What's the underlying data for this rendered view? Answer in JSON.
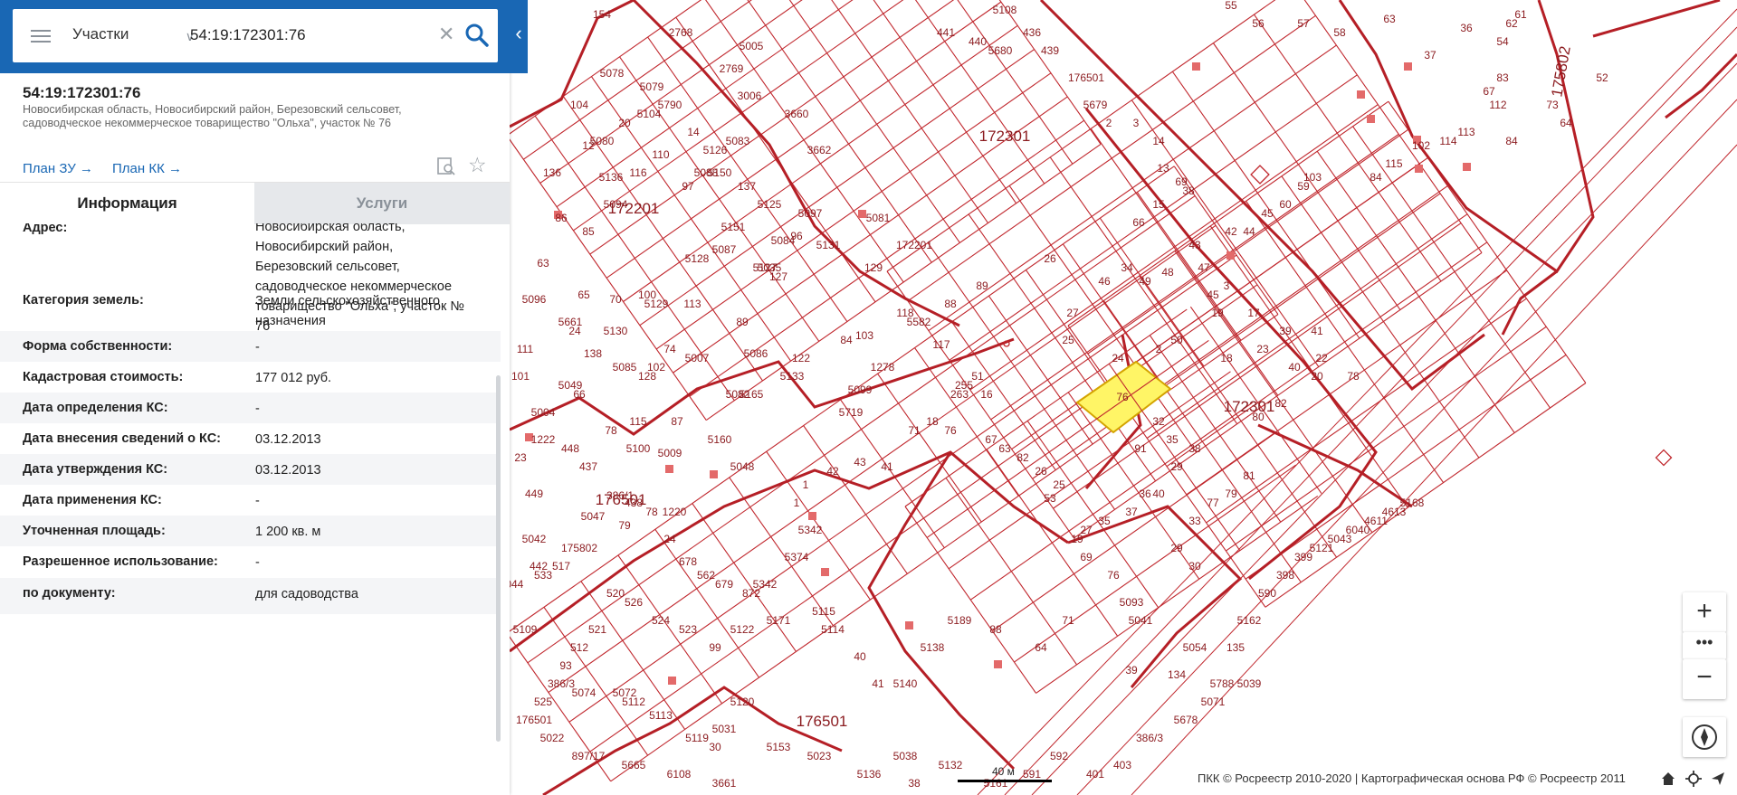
{
  "search": {
    "layer": "Участки",
    "query": "54:19:172301:76"
  },
  "object": {
    "number": "54:19:172301:76",
    "address_lines": [
      "Новосибирская область, Новосибирский район, Березовский сельсовет,",
      "садоводческое некоммерческое товарищество \"Ольха\", участок № 76"
    ],
    "plan_zu": "План ЗУ",
    "plan_kk": "План КК"
  },
  "tabs": {
    "info": "Информация",
    "services": "Услуги"
  },
  "properties": [
    {
      "label": "Адрес:",
      "value_lines": [
        "Новосибирская область,",
        "Новосибирский район,",
        "Березовский сельсовет,",
        "садоводческое некоммерческое",
        "товарищество \"Ольха\", участок №",
        "76"
      ]
    },
    {
      "label": "Категория земель:",
      "value_lines": [
        "Земли сельскохозяйственного",
        "назначения"
      ]
    },
    {
      "label": "Форма собственности:",
      "value_lines": [
        "-"
      ]
    },
    {
      "label": "Кадастровая стоимость:",
      "value_lines": [
        "177 012 руб."
      ]
    },
    {
      "label": "Дата определения КС:",
      "value_lines": [
        "-"
      ]
    },
    {
      "label": "Дата внесения сведений о КС:",
      "value_lines": [
        "03.12.2013"
      ]
    },
    {
      "label": "Дата утверждения КС:",
      "value_lines": [
        "03.12.2013"
      ]
    },
    {
      "label": "Дата применения КС:",
      "value_lines": [
        "-"
      ]
    },
    {
      "label": "Уточненная площадь:",
      "value_lines": [
        "1 200 кв. м"
      ]
    },
    {
      "label": "Разрешенное использование:",
      "value_lines": [
        "-"
      ]
    },
    {
      "label": "по документу:",
      "value_lines": [
        "для садоводства"
      ]
    }
  ],
  "map": {
    "quarters": [
      "172301",
      "172301",
      "172201",
      "176501",
      "176501",
      "175802"
    ],
    "selected_parcel": "76",
    "parcel_labels": [
      "154",
      "2768",
      "5005",
      "5079",
      "5790",
      "2769",
      "3006",
      "3660",
      "3662",
      "104",
      "5078",
      "5104",
      "20",
      "12",
      "5080",
      "14",
      "5126",
      "5083",
      "110",
      "5088",
      "136",
      "5136",
      "116",
      "97",
      "5150",
      "137",
      "5094",
      "5081",
      "172201",
      "86",
      "85",
      "5151",
      "5125",
      "5127",
      "96",
      "5097",
      "5084",
      "5131",
      "129",
      "63",
      "65",
      "70",
      "100",
      "113",
      "5128",
      "5087",
      "5035",
      "88",
      "89",
      "5096",
      "24",
      "5130",
      "5129",
      "89",
      "127",
      "103",
      "118",
      "111",
      "5661",
      "138",
      "128",
      "5007",
      "5086",
      "122",
      "84",
      "117",
      "5582",
      "101",
      "5049",
      "5085",
      "102",
      "74",
      "5082",
      "5165",
      "5133",
      "1278",
      "5099",
      "5004",
      "66",
      "78",
      "115",
      "87",
      "5160",
      "1222",
      "448",
      "5100",
      "5009",
      "5048",
      "5719",
      "23",
      "437",
      "449",
      "5047",
      "438",
      "1220",
      "386/1",
      "442",
      "5108",
      "436",
      "439",
      "441",
      "440",
      "5680",
      "176501",
      "5679",
      "2",
      "3",
      "14",
      "13",
      "69",
      "38",
      "15",
      "66",
      "55",
      "56",
      "57",
      "58",
      "63",
      "37",
      "36",
      "54",
      "83",
      "61",
      "62",
      "73",
      "64",
      "52",
      "84",
      "67",
      "112",
      "113",
      "114",
      "102",
      "115",
      "84",
      "103",
      "59",
      "60",
      "45",
      "44",
      "42",
      "43",
      "47",
      "48",
      "49",
      "46",
      "27",
      "26",
      "25",
      "24",
      "2",
      "50",
      "45",
      "3",
      "19",
      "17",
      "18",
      "23",
      "39",
      "41",
      "22",
      "40",
      "20",
      "78",
      "82",
      "80",
      "81",
      "79",
      "77",
      "33",
      "29",
      "30",
      "91",
      "34",
      "32",
      "35",
      "38",
      "29",
      "40",
      "36",
      "37",
      "35",
      "27",
      "19",
      "25",
      "53",
      "26",
      "82",
      "63",
      "67",
      "16",
      "51",
      "255",
      "263",
      "18",
      "76",
      "71",
      "41",
      "43",
      "42",
      "1",
      "1",
      "5342",
      "5374",
      "5342",
      "872",
      "679",
      "562",
      "678",
      "24",
      "78",
      "79",
      "175802",
      "517",
      "533",
      "5042",
      "5044",
      "5109",
      "93",
      "5074",
      "5072",
      "5112",
      "5113",
      "5119",
      "30",
      "5031",
      "5120",
      "5153",
      "5023",
      "5136",
      "5038",
      "5132",
      "5161",
      "591",
      "592",
      "401",
      "403",
      "386/3",
      "5678",
      "5071",
      "5788",
      "135",
      "5162",
      "590",
      "398",
      "399",
      "5121",
      "5043",
      "6040",
      "4611",
      "4613",
      "5168",
      "5039",
      "38",
      "39",
      "5054",
      "134",
      "5041",
      "5093",
      "76",
      "69",
      "71",
      "64",
      "88",
      "5189",
      "5138",
      "5140",
      "41",
      "40",
      "5114",
      "5115",
      "5171",
      "5122",
      "99",
      "523",
      "524",
      "526",
      "520",
      "521",
      "512",
      "386/3",
      "525",
      "176501",
      "5022",
      "897/17",
      "5665",
      "6108",
      "3661"
    ],
    "scale_label": "40 м"
  },
  "attribution": "ПКК © Росреестр 2010-2020 | Картографическая основа РФ © Росреестр 2011"
}
